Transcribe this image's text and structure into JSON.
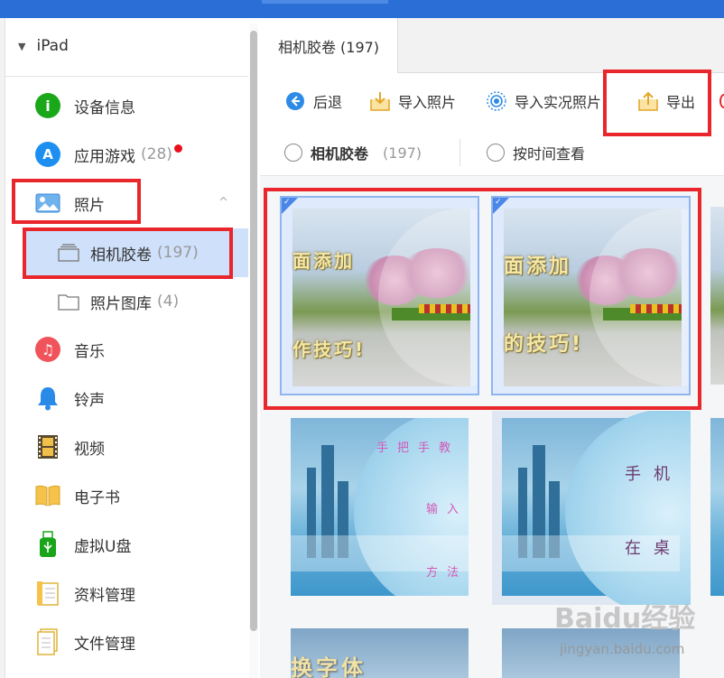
{
  "device": {
    "name": "iPad"
  },
  "sidebar": {
    "items": [
      {
        "label": "设备信息",
        "icon": "info-icon",
        "color": "#1aa81a"
      },
      {
        "label": "应用游戏",
        "count": "(28)",
        "icon": "app-store-icon",
        "color": "#1d8ff0"
      },
      {
        "label": "照片",
        "icon": "photo-icon"
      },
      {
        "label": "音乐",
        "icon": "music-icon",
        "color": "#f0545a"
      },
      {
        "label": "铃声",
        "icon": "bell-icon",
        "color": "#2a8ae8"
      },
      {
        "label": "视频",
        "icon": "film-icon"
      },
      {
        "label": "电子书",
        "icon": "book-icon"
      },
      {
        "label": "虚拟U盘",
        "icon": "usb-icon",
        "color": "#18a51a"
      },
      {
        "label": "资料管理",
        "icon": "notes-icon"
      },
      {
        "label": "文件管理",
        "icon": "file-icon"
      }
    ],
    "photo_sub": [
      {
        "label": "相机胶卷",
        "count": "(197)"
      },
      {
        "label": "照片图库",
        "count": "(4)"
      }
    ]
  },
  "tab": {
    "label": "相机胶卷 (197)"
  },
  "toolbar": {
    "back": "后退",
    "import_photo": "导入照片",
    "import_live": "导入实况照片",
    "export": "导出"
  },
  "filter": {
    "camera_roll": "相机胶卷",
    "camera_roll_count": "(197)",
    "by_time": "按时间查看"
  },
  "photos": {
    "p1": {
      "line1": "面添加",
      "line2": "作技巧!"
    },
    "p2": {
      "line1": "面添加",
      "line2": "的技巧!"
    },
    "p3": {
      "t1": "手把手教",
      "t2": "输入",
      "t3": "方法"
    },
    "p4": {
      "t1": "手机",
      "t2": "在桌"
    },
    "p5": {
      "t1": "换字体"
    }
  },
  "watermark": {
    "logo": "Baidu经验",
    "url": "jingyan.baidu.com"
  },
  "colors": {
    "accent": "#2b6fd6",
    "highlight": "#e8262b",
    "selected": "#cfe0fa"
  }
}
